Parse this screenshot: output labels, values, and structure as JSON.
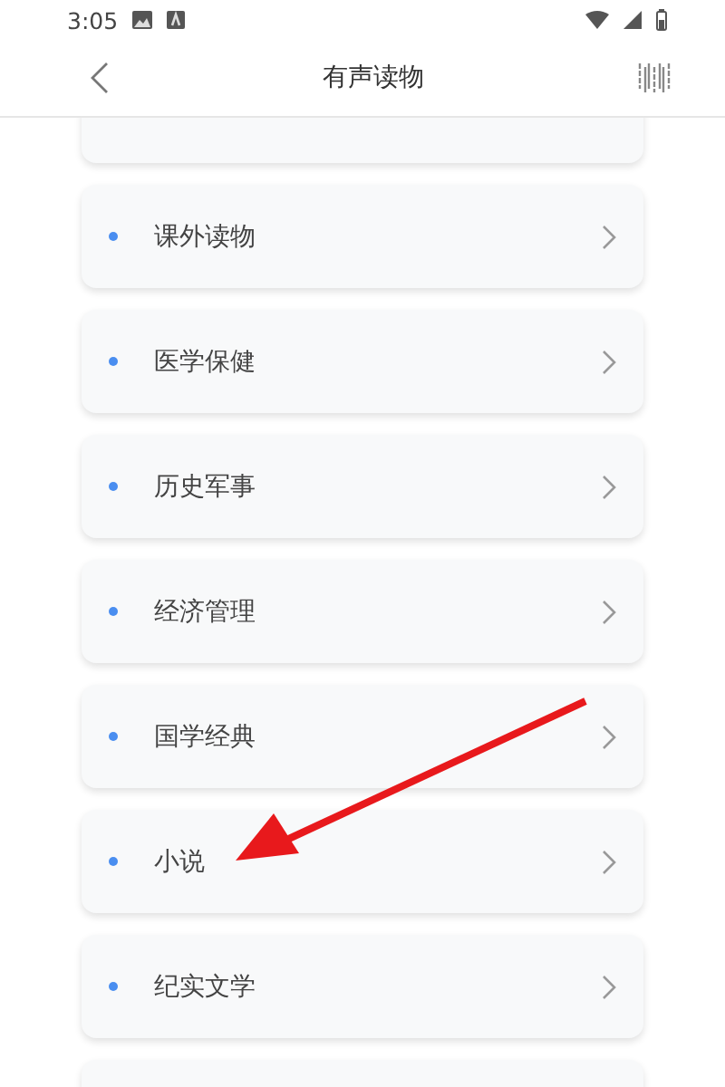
{
  "status_bar": {
    "time": "3:05"
  },
  "header": {
    "title": "有声读物"
  },
  "categories": [
    {
      "label": "课外读物"
    },
    {
      "label": "医学保健"
    },
    {
      "label": "历史军事"
    },
    {
      "label": "经济管理"
    },
    {
      "label": "国学经典"
    },
    {
      "label": "小说"
    },
    {
      "label": "纪实文学"
    }
  ]
}
